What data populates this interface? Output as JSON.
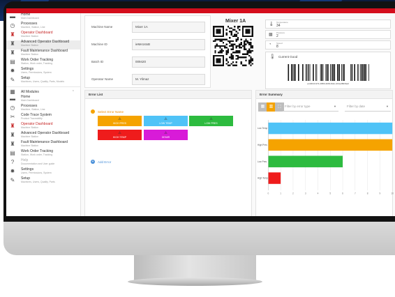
{
  "sidebar": {
    "top_items": [
      {
        "title": "Home",
        "sub": "Main Dashboard",
        "icon": "dashboard-icon",
        "glyph": "▬",
        "style": ""
      },
      {
        "title": "Processes",
        "sub": "Machine, Station, Line",
        "icon": "clock-icon",
        "glyph": "◷",
        "style": ""
      },
      {
        "title": "Operator Dashboard",
        "sub": "Machine Station",
        "icon": "worker-icon",
        "glyph": "♜",
        "style": "red"
      },
      {
        "title": "Advanced Operator Dashboard",
        "sub": "Machine Station",
        "icon": "worker-icon",
        "glyph": "♜",
        "style": "active"
      },
      {
        "title": "Fault Maintenance Dashboard",
        "sub": "Machine Station",
        "icon": "worker-icon",
        "glyph": "♜",
        "style": ""
      },
      {
        "title": "Work Order Tracking",
        "sub": "Station, Work order, Tracking",
        "icon": "list-icon",
        "glyph": "▤",
        "style": ""
      },
      {
        "title": "Settings",
        "sub": "Users, Permissions, System",
        "icon": "gear-icon",
        "glyph": "✹",
        "style": ""
      },
      {
        "title": "Setup",
        "sub": "Machines, Users, Quality, Parts, Models",
        "icon": "wrench-icon",
        "glyph": "✎",
        "style": ""
      }
    ],
    "all_modules_label": "All Modules",
    "module_items": [
      {
        "title": "Home",
        "sub": "Main Dashboard",
        "icon": "dashboard-icon",
        "glyph": "▬",
        "style": ""
      },
      {
        "title": "Processes",
        "sub": "Machine, Station, Line",
        "icon": "clock-icon",
        "glyph": "◷",
        "style": ""
      },
      {
        "title": "Code Trace System",
        "sub": "Product Traceability",
        "icon": "trace-icon",
        "glyph": "✂",
        "style": ""
      },
      {
        "title": "Operator Dashboard",
        "sub": "Machine Station",
        "icon": "worker-icon",
        "glyph": "♜",
        "style": "red"
      },
      {
        "title": "Advanced Operator Dashboard",
        "sub": "Machine Station",
        "icon": "worker-icon",
        "glyph": "♜",
        "style": ""
      },
      {
        "title": "Fault Maintenance Dashboard",
        "sub": "Machine Station",
        "icon": "worker-icon",
        "glyph": "♜",
        "style": ""
      },
      {
        "title": "Work Order Tracking",
        "sub": "Station, Work order, Tracking",
        "icon": "list-icon",
        "glyph": "▤",
        "style": ""
      },
      {
        "title": "Help",
        "sub": "Documentation and User guide",
        "icon": "help-icon",
        "glyph": "?",
        "style": "faded"
      },
      {
        "title": "Settings",
        "sub": "Users, Permissions, System",
        "icon": "gear-icon",
        "glyph": "✹",
        "style": ""
      },
      {
        "title": "Setup",
        "sub": "Machines, Users, Quality, Parts",
        "icon": "wrench-icon",
        "glyph": "✎",
        "style": ""
      }
    ]
  },
  "machine": {
    "fields": [
      {
        "label": "Machine Name",
        "value": "Mixer 1A"
      },
      {
        "label": "Machine ID",
        "value": "ieMe1stxB"
      },
      {
        "label": "Batch ID",
        "value": "009420"
      },
      {
        "label": "Operator Name",
        "value": "M. Yilmaz"
      }
    ],
    "title": "Mixer 1A"
  },
  "sensors": [
    {
      "label": "Temperature",
      "value": "34",
      "icon": "thermometer-icon",
      "glyph": "🌡"
    },
    {
      "label": "Pressure",
      "value": "2",
      "icon": "pressure-icon",
      "glyph": "▩"
    },
    {
      "label": "Speed",
      "value": "8",
      "icon": "speed-icon",
      "glyph": "◔"
    }
  ],
  "status": {
    "text": "Current Good",
    "icon": "thermometer-icon",
    "barcode_id": "ec40013-971-F883-40F9-8dcc-4f4cef803ba3"
  },
  "error_list": {
    "title": "Error List",
    "select_label": "Select Error Name",
    "add_label": "Add Error",
    "buttons": [
      {
        "label": "HIGH PRES",
        "color": "#f5a300",
        "icon": "alert-icon"
      },
      {
        "label": "LOW TEMP",
        "color": "#4fc3f7",
        "icon": "alert-icon"
      },
      {
        "label": "LOW PRES",
        "color": "#2dbb3f",
        "icon": "alert-icon"
      },
      {
        "label": "HIGH TEMP",
        "color": "#ef1c1c",
        "icon": "alert-icon"
      },
      {
        "label": "DEMIR",
        "color": "#d81bd8",
        "icon": "alert-icon"
      }
    ]
  },
  "error_summary": {
    "title": "Error Summary",
    "filter_type_placeholder": "Filter by error type",
    "filter_date_placeholder": "Filter by date",
    "view_buttons": [
      {
        "icon": "grid-view-icon",
        "glyph": "▦",
        "active": false
      },
      {
        "icon": "bar-chart-icon",
        "glyph": "▥",
        "active": true
      },
      {
        "icon": "export-icon",
        "glyph": "⬚",
        "active": false
      }
    ]
  },
  "chart_data": {
    "type": "bar",
    "orientation": "horizontal",
    "categories": [
      "Low Temp",
      "High Pres",
      "Low Pres",
      "High Temp"
    ],
    "values": [
      10,
      10,
      6,
      1
    ],
    "colors": [
      "#4fc3f7",
      "#f5a300",
      "#2dbb3f",
      "#ef1c1c"
    ],
    "xlim": [
      0,
      10
    ],
    "xticks": [
      0,
      1,
      2,
      3,
      4,
      5,
      6,
      7,
      8,
      9,
      10
    ],
    "grid": true
  }
}
